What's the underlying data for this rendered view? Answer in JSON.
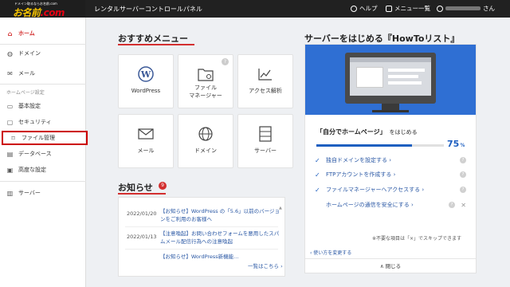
{
  "header": {
    "logo_small": "ドメイン取るならお名前.com",
    "logo_main": "お名前",
    "logo_tld": ".com",
    "title": "レンタルサーバーコントロールパネル",
    "help": "ヘルプ",
    "menu": "メニュー一覧",
    "user_suffix": "さん"
  },
  "sidebar": {
    "items": [
      {
        "label": "ホーム",
        "icon": "home-icon"
      },
      {
        "label": "ドメイン",
        "icon": "globe-icon"
      },
      {
        "label": "メール",
        "icon": "mail-icon"
      }
    ],
    "section_label": "ホームページ設定",
    "site_items": [
      {
        "label": "基本設定",
        "icon": "monitor-icon"
      },
      {
        "label": "セキュリティ",
        "icon": "lock-icon"
      },
      {
        "label": "ファイル管理",
        "icon": "folder-icon"
      },
      {
        "label": "データベース",
        "icon": "database-icon"
      },
      {
        "label": "高度な設定",
        "icon": "settings-icon"
      }
    ],
    "server_item": {
      "label": "サーバー",
      "icon": "server-icon"
    }
  },
  "recommended": {
    "title": "おすすめメニュー",
    "tiles": [
      {
        "label": "WordPress",
        "icon": "wordpress-icon"
      },
      {
        "label": "ファイル\nマネージャー",
        "icon": "folder-icon",
        "badge": "?"
      },
      {
        "label": "アクセス解析",
        "icon": "chart-icon"
      },
      {
        "label": "メール",
        "icon": "mail-icon"
      },
      {
        "label": "ドメイン",
        "icon": "www-icon"
      },
      {
        "label": "サーバー",
        "icon": "server-icon"
      }
    ]
  },
  "news": {
    "title": "お知らせ",
    "badge": "9",
    "items": [
      {
        "date": "2022/01/20",
        "text": "【お知らせ】WordPress の「5.6」以前のバージョンをご利用のお客様へ"
      },
      {
        "date": "2022/01/13",
        "text": "【注意喚起】お問い合わせフォームを悪用したスパムメール配信行為への注意喚起"
      },
      {
        "date": "",
        "text": "【お知らせ】WordPress新機能..."
      }
    ],
    "more": "一覧はこちら ›"
  },
  "howto": {
    "title": "サーバーをはじめる『HowToリスト』",
    "heading": "「自分でホームページ」",
    "heading_sub": "をはじめる",
    "progress_pct": 75,
    "progress_label": "75",
    "progress_unit": "%",
    "tasks": [
      {
        "label": "独自ドメインを設定する ›",
        "done": true
      },
      {
        "label": "FTPアカウントを作成する ›",
        "done": true
      },
      {
        "label": "ファイルマネージャーへアクセスする ›",
        "done": true
      },
      {
        "label": "ホームページの通信を安全にする ›",
        "done": false
      }
    ],
    "note": "※不要な項目は「×」でスキップできます",
    "link": "‹ 使い方を変更する",
    "close": "∧  閉じる"
  },
  "colors": {
    "accent": "#d32f2f",
    "link": "#2957a4",
    "progress": "#1e5fc0",
    "hero": "#2f6fd3"
  }
}
